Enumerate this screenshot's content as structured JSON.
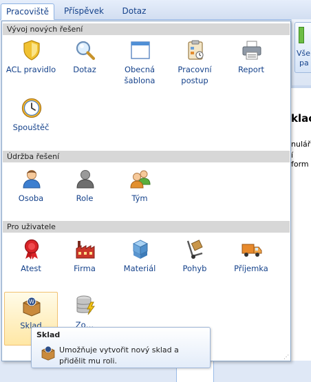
{
  "tabs": [
    {
      "label": "Pracoviště",
      "underline_char": "P"
    },
    {
      "label": "Příspěvek",
      "underline_char": "ř"
    },
    {
      "label": "Dotaz",
      "underline_char": ""
    }
  ],
  "background": {
    "button_line1": "Vše",
    "button_line2": "pa",
    "heading": "klac",
    "text1": "nulář",
    "text2": "í form"
  },
  "sections": [
    {
      "title": "Vývoj nových řešení",
      "items": [
        {
          "label": "ACL pravidlo",
          "icon": "shield-icon"
        },
        {
          "label": "Dotaz",
          "icon": "magnifier-icon"
        },
        {
          "label": "Obecná šablona",
          "icon": "window-template-icon"
        },
        {
          "label": "Pracovní postup",
          "icon": "clipboard-workflow-icon"
        },
        {
          "label": "Report",
          "icon": "printer-icon"
        },
        {
          "label": "Spouštěč",
          "icon": "clock-icon"
        }
      ]
    },
    {
      "title": "Údržba řešení",
      "items": [
        {
          "label": "Osoba",
          "icon": "person-icon"
        },
        {
          "label": "Role",
          "icon": "role-icon"
        },
        {
          "label": "Tým",
          "icon": "team-icon"
        }
      ]
    },
    {
      "title": "Pro uživatele",
      "items": [
        {
          "label": "Atest",
          "icon": "ribbon-award-icon"
        },
        {
          "label": "Firma",
          "icon": "factory-icon"
        },
        {
          "label": "Materiál",
          "icon": "cubes-icon"
        },
        {
          "label": "Pohyb",
          "icon": "hand-truck-icon"
        },
        {
          "label": "Příjemka",
          "icon": "delivery-truck-icon"
        },
        {
          "label": "Sklad",
          "icon": "warehouse-box-icon",
          "selected": true
        },
        {
          "label": "Zo…",
          "icon": "database-power-icon"
        }
      ]
    }
  ],
  "tooltip": {
    "title": "Sklad",
    "text": "Umožňuje vytvořit nový sklad a přidělit mu roli."
  },
  "colors": {
    "label": "#15428b",
    "section_bg": "#d7d7d7",
    "accent_border": "#99bbe8"
  }
}
